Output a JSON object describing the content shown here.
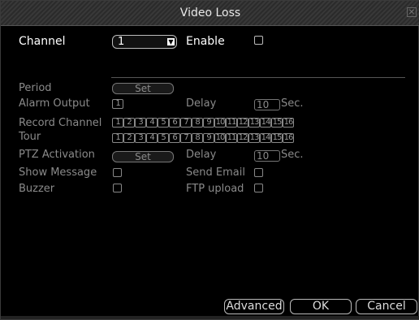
{
  "title": "Video Loss",
  "channel": {
    "label": "Channel",
    "value": "1"
  },
  "enable": {
    "label": "Enable",
    "checked": false
  },
  "period": {
    "label": "Period",
    "button": "Set"
  },
  "alarm_output": {
    "label": "Alarm Output",
    "value": "1",
    "delay_label": "Delay",
    "delay_value": "10",
    "unit": "Sec."
  },
  "record_channel": {
    "label": "Record Channel",
    "channels": [
      "1",
      "2",
      "3",
      "4",
      "5",
      "6",
      "7",
      "8",
      "9",
      "10",
      "11",
      "12",
      "13",
      "14",
      "15",
      "16"
    ]
  },
  "tour": {
    "label": "Tour",
    "channels": [
      "1",
      "2",
      "3",
      "4",
      "5",
      "6",
      "7",
      "8",
      "9",
      "10",
      "11",
      "12",
      "13",
      "14",
      "15",
      "16"
    ]
  },
  "ptz": {
    "label": "PTZ Activation",
    "button": "Set",
    "delay_label": "Delay",
    "delay_value": "10",
    "unit": "Sec."
  },
  "show_message": {
    "label": "Show Message",
    "checked": false
  },
  "send_email": {
    "label": "Send Email",
    "checked": false
  },
  "buzzer": {
    "label": "Buzzer",
    "checked": false
  },
  "ftp_upload": {
    "label": "FTP upload",
    "checked": false
  },
  "buttons": {
    "advanced": "Advanced",
    "ok": "OK",
    "cancel": "Cancel"
  }
}
